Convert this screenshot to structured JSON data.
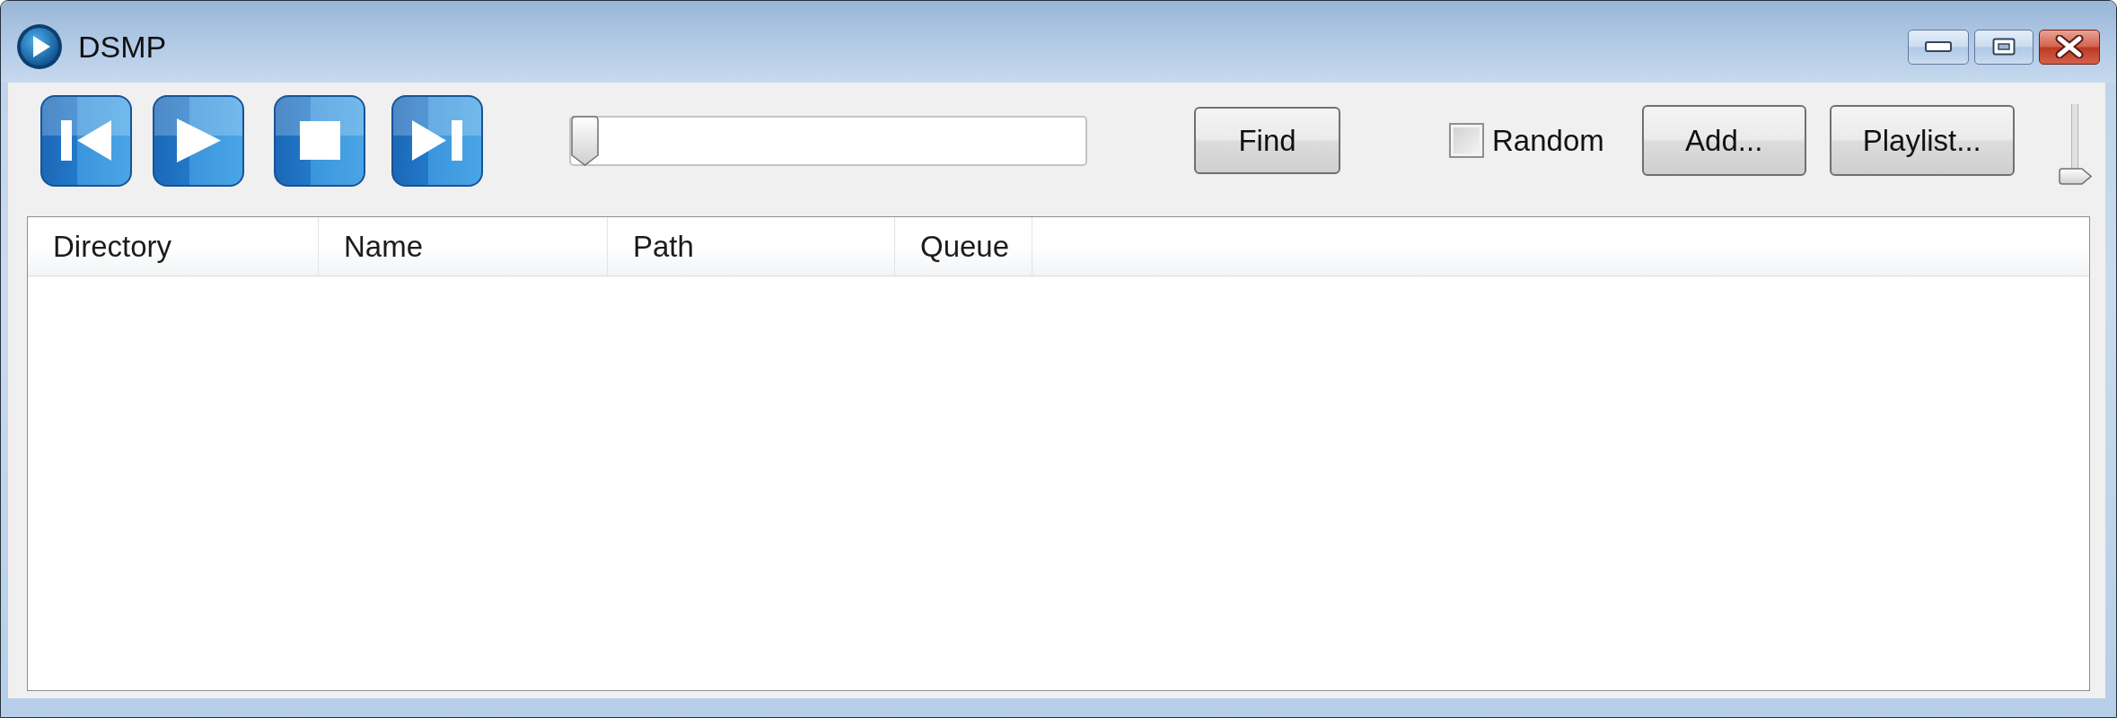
{
  "window": {
    "title": "DSMP"
  },
  "toolbar": {
    "transport": [
      {
        "kind": "previous"
      },
      {
        "kind": "play"
      },
      {
        "kind": "stop"
      },
      {
        "kind": "next"
      }
    ],
    "seek": {
      "level": 0
    },
    "find_button": {
      "label": "Find"
    },
    "random": {
      "label": "Random",
      "checked": false
    },
    "add_button": {
      "label": "Add..."
    },
    "playlist_button": {
      "label": "Playlist..."
    },
    "volume": {
      "level": 0
    }
  },
  "table": {
    "columns": [
      "Directory",
      "Name",
      "Path",
      "Queue"
    ]
  }
}
